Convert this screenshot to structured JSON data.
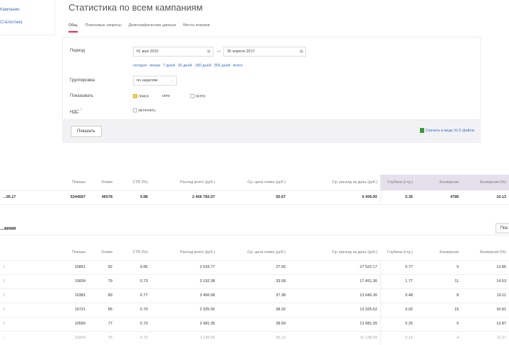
{
  "sidebar": {
    "links": [
      "Кампании",
      "Статистика"
    ]
  },
  "title": "Статистика по всем кампаниям",
  "tabs": [
    "Общ.",
    "Поисковые запросы",
    "Демографические данные",
    "Места показов"
  ],
  "form": {
    "period_label": "Период",
    "date_from": "01 мая 2016",
    "date_sep": "—",
    "date_to": "30 апреля 2017",
    "quick": [
      "сегодня",
      "вчера",
      "7 дней",
      "30 дней",
      "180 дней",
      "365 дней",
      "всего"
    ],
    "group_label": "Группировка",
    "group_value": "по неделям",
    "show_label": "Показывать",
    "show_opts": [
      "поиск",
      "сети",
      "всего"
    ],
    "vat_label": "НДС",
    "vat_hint": "?",
    "vat_opt": "включить",
    "submit": "Показать",
    "xls": "Скачать в виде XLS файла"
  },
  "totals": {
    "headers": [
      "Показы",
      "Клики",
      "CTR (%)",
      "Расход всего (руб.)",
      "Ср. цена клика (руб.)",
      "Ср. расход за день (руб.)",
      "Глубина (стр.)",
      "Конверсия",
      "Конверсия (%)"
    ],
    "row": [
      "...05.17",
      "5344667",
      "46578",
      "0.88",
      "2 406 783.07",
      "55.67",
      "6 409.00",
      "5.35",
      "4789",
      "10.13"
    ]
  },
  "section": {
    "title": "...ания",
    "button": "Пок..."
  },
  "detail": {
    "headers": [
      "Показы",
      "Клики",
      "CTR (%)",
      "Расход всего (руб.)",
      "Ср. цена клика (руб.)",
      "Ср. расход за день (руб.)",
      "Глубина (стр.)",
      "Конверсия",
      "Конверсия (%)"
    ],
    "rows": [
      [
        "1",
        "10851",
        "92",
        "0.85",
        "2 533.77",
        "27.55",
        "27 522.17",
        "5.77",
        "5",
        "13.85"
      ],
      [
        "2",
        "10834",
        "79",
        "0.73",
        "2 192.38",
        "33.58",
        "17 451.36",
        "1.77",
        "11",
        "14.53"
      ],
      [
        "3",
        "10381",
        "83",
        "0.77",
        "3 456.58",
        "37.38",
        "13 645.36",
        "5.48",
        "8",
        "10.11"
      ],
      [
        "4",
        "10721",
        "85",
        "0.79",
        "2 325.55",
        "38.32",
        "13 325.52",
        "6.02",
        "15",
        "16.81"
      ],
      [
        "5",
        "10556",
        "77",
        "0.73",
        "2 981.35",
        "38.59",
        "13 981.35",
        "5.25",
        "6",
        "12.87"
      ],
      [
        "6",
        "10254",
        "75",
        "0.73",
        "1 138.55",
        "35.12",
        "11 138.55",
        "5.13",
        "4",
        "11.27"
      ]
    ]
  }
}
